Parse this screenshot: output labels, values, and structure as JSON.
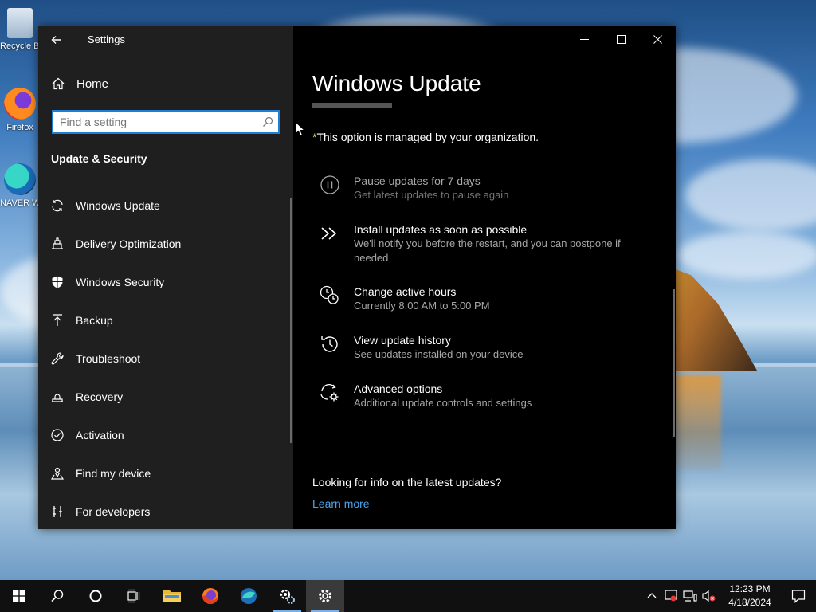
{
  "desktop": {
    "icons": [
      {
        "label": "Recycle Bin"
      },
      {
        "label": "Firefox"
      },
      {
        "label": "NAVER Whale"
      }
    ]
  },
  "window": {
    "app_title": "Settings",
    "controls": {
      "minimize": "—",
      "maximize": "☐",
      "close": "✕"
    }
  },
  "sidebar": {
    "home_label": "Home",
    "search_placeholder": "Find a setting",
    "section_title": "Update & Security",
    "items": [
      {
        "label": "Windows Update",
        "icon": "refresh-icon"
      },
      {
        "label": "Delivery Optimization",
        "icon": "delivery-icon"
      },
      {
        "label": "Windows Security",
        "icon": "shield-icon"
      },
      {
        "label": "Backup",
        "icon": "upload-icon"
      },
      {
        "label": "Troubleshoot",
        "icon": "wrench-icon"
      },
      {
        "label": "Recovery",
        "icon": "recovery-icon"
      },
      {
        "label": "Activation",
        "icon": "check-circle-icon"
      },
      {
        "label": "Find my device",
        "icon": "person-location-icon"
      },
      {
        "label": "For developers",
        "icon": "developer-tools-icon"
      }
    ]
  },
  "main": {
    "title": "Windows Update",
    "managed_star": "*",
    "managed_text": "This option is managed by your organization.",
    "options": [
      {
        "title": "Pause updates for 7 days",
        "desc": "Get latest updates to pause again",
        "icon": "pause-icon",
        "disabled": true
      },
      {
        "title": "Install updates as soon as possible",
        "desc": "We'll notify you before the restart, and you can postpone if needed",
        "icon": "fast-forward-icon",
        "disabled": false
      },
      {
        "title": "Change active hours",
        "desc": "Currently 8:00 AM to 5:00 PM",
        "icon": "clock-icon",
        "disabled": false
      },
      {
        "title": "View update history",
        "desc": "See updates installed on your device",
        "icon": "history-icon",
        "disabled": false
      },
      {
        "title": "Advanced options",
        "desc": "Additional update controls and settings",
        "icon": "advanced-gear-icon",
        "disabled": false
      }
    ],
    "info_question": "Looking for info on the latest updates?",
    "learn_more": "Learn more"
  },
  "taskbar": {
    "time": "12:23 PM",
    "date": "4/18/2024"
  },
  "colors": {
    "accent": "#1e7fd6",
    "link": "#4aa3ef",
    "sidebar_bg": "#1f1f1f",
    "content_bg": "#000000"
  }
}
